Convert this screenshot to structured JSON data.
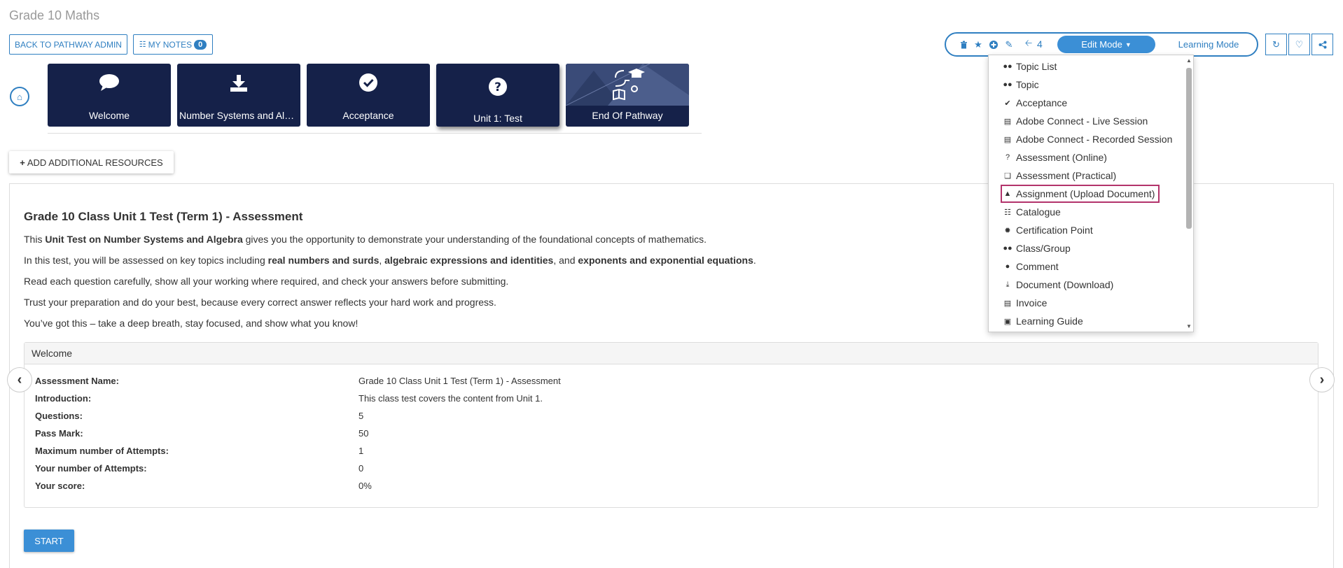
{
  "page": {
    "title": "Grade 10 Maths"
  },
  "header": {
    "back_label": "BACK TO PATHWAY ADMIN",
    "notes_label": "MY NOTES",
    "notes_count": "0"
  },
  "toolbar": {
    "count": "4",
    "edit_mode": "Edit Mode",
    "learning_mode": "Learning Mode"
  },
  "tiles": [
    {
      "label": "Welcome"
    },
    {
      "label": "Number Systems and Algebra"
    },
    {
      "label": "Acceptance"
    },
    {
      "label": "Unit 1: Test"
    },
    {
      "label": "End Of Pathway"
    }
  ],
  "add_resources_label": "ADD ADDITIONAL RESOURCES",
  "assessment": {
    "title": "Grade 10 Class Unit 1 Test (Term 1) - Assessment",
    "p1": {
      "a": "This ",
      "b": "Unit Test on Number Systems and Algebra",
      "c": " gives you the opportunity to demonstrate your understanding of the foundational concepts of mathematics."
    },
    "p2": {
      "a": "In this test, you will be assessed on key topics including ",
      "b1": "real numbers and surds",
      "s1": ", ",
      "b2": "algebraic expressions and identities",
      "s2": ", and ",
      "b3": "exponents and exponential equations",
      "end": "."
    },
    "p3": "Read each question carefully, show all your working where required, and check your answers before submitting.",
    "p4": "Trust your preparation and do your best, because every correct answer reflects your hard work and progress.",
    "p5": "You’ve got this – take a deep breath, stay focused, and show what you know!"
  },
  "details": {
    "heading": "Welcome",
    "rows": [
      {
        "label": "Assessment Name:",
        "value": "Grade 10 Class Unit 1 Test (Term 1) - Assessment"
      },
      {
        "label": "Introduction:",
        "value": "This class test covers the content from Unit 1."
      },
      {
        "label": "Questions:",
        "value": "5"
      },
      {
        "label": "Pass Mark:",
        "value": "50"
      },
      {
        "label": "Maximum number of Attempts:",
        "value": "1"
      },
      {
        "label": "Your number of Attempts:",
        "value": "0"
      },
      {
        "label": "Your score:",
        "value": "0%"
      }
    ]
  },
  "start_label": "START",
  "dropdown": {
    "items": [
      {
        "label": "Topic List",
        "icon": "users-icon"
      },
      {
        "label": "Topic",
        "icon": "users-icon"
      },
      {
        "label": "Acceptance",
        "icon": "check-circle-icon"
      },
      {
        "label": "Adobe Connect - Live Session",
        "icon": "file-icon"
      },
      {
        "label": "Adobe Connect - Recorded Session",
        "icon": "file-icon"
      },
      {
        "label": "Assessment (Online)",
        "icon": "question-circle-icon"
      },
      {
        "label": "Assessment (Practical)",
        "icon": "copy-icon"
      },
      {
        "label": "Assignment (Upload Document)",
        "icon": "upload-icon"
      },
      {
        "label": "Catalogue",
        "icon": "newspaper-icon"
      },
      {
        "label": "Certification Point",
        "icon": "certificate-icon"
      },
      {
        "label": "Class/Group",
        "icon": "users-icon"
      },
      {
        "label": "Comment",
        "icon": "comment-icon"
      },
      {
        "label": "Document (Download)",
        "icon": "download-icon"
      },
      {
        "label": "Invoice",
        "icon": "file-text-icon"
      },
      {
        "label": "Learning Guide",
        "icon": "book-icon"
      }
    ]
  },
  "colors": {
    "primary": "#2f7fc1",
    "tile": "#152149",
    "highlight": "#b3336b"
  }
}
